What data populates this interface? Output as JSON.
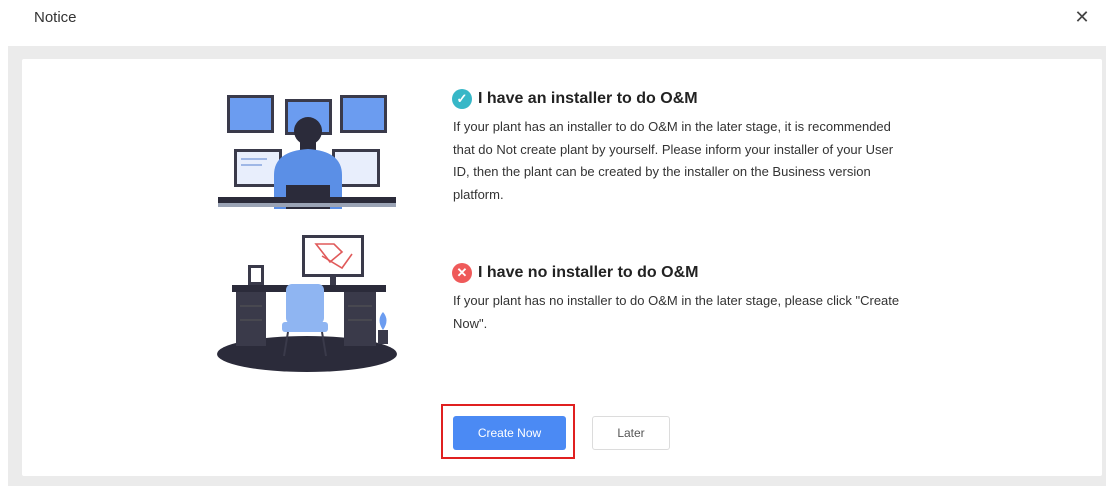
{
  "dialog": {
    "title": "Notice",
    "close_icon": "close-icon"
  },
  "options": [
    {
      "icon": "check-circle-icon",
      "color": "#37b7c7",
      "heading": "I have an installer to do O&M",
      "lines": [
        "If your plant has an installer to do O&M in the later stage, it is recommended",
        "that do Not create plant by yourself. Please inform your installer of your User",
        "ID, then the plant can be created by the installer on the Business version",
        "platform."
      ]
    },
    {
      "icon": "x-circle-icon",
      "color": "#ef5a5a",
      "heading": "I have no installer to do O&M",
      "lines": [
        "If your plant has no installer to do O&M in the later stage, please click \"Create",
        "Now\"."
      ]
    }
  ],
  "buttons": {
    "primary_label": "Create Now",
    "secondary_label": "Later",
    "primary_color": "#4b8af4",
    "highlight_color": "#e02020"
  }
}
